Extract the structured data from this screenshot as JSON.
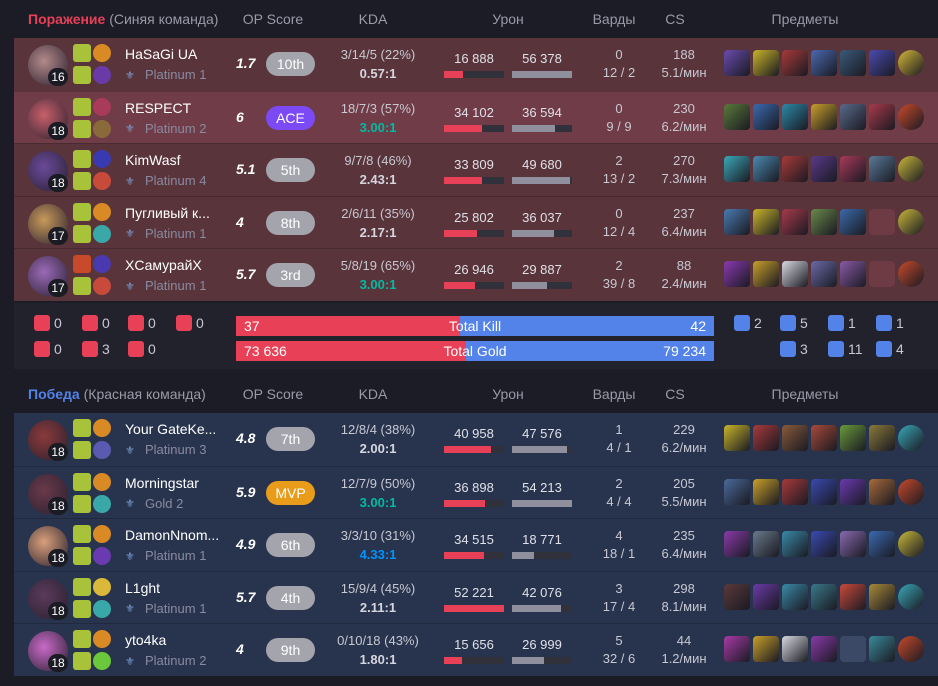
{
  "colors": {
    "loss": "#e84057",
    "win": "#5383e8",
    "ace": "#7b4af5",
    "mvp": "#e89c1a",
    "kda_good": "#00bba3",
    "kda_great": "#0093ff"
  },
  "columns": {
    "op_score": "OP Score",
    "kda": "KDA",
    "damage": "Урон",
    "wards": "Варды",
    "cs": "CS",
    "items": "Предметы"
  },
  "blue_team": {
    "result": "Поражение",
    "side": "(Синяя команда)",
    "players": [
      {
        "name": "HaSaGi UA",
        "level": "16",
        "tier": "Platinum 1",
        "score": "1.7",
        "rank": "10th",
        "kda": "3/14/5 (22%)",
        "ratio": "0.57:1",
        "dealt": "16 888",
        "taken": "56 378",
        "dealt_pct": 0.32,
        "taken_pct": 1.0,
        "wards": "0",
        "wards2": "12 / 2",
        "cs": "188",
        "cspm": "5.1/мин",
        "champ": "#b38a8a",
        "spells": [
          "#a8c23a",
          "#d98a24",
          "#a8c23a",
          "#6a3aa8"
        ],
        "items": [
          "#6a4bb0",
          "#c9b52a",
          "#a83a3a",
          "#4a6ab0",
          "#3a5a7a",
          "#4a4ab0",
          "#d4b83a"
        ]
      },
      {
        "name": "RESPECT",
        "level": "18",
        "tier": "Platinum 2",
        "score": "6",
        "rank": "ACE",
        "kda": "18/7/3 (57%)",
        "ratio": "3.00:1",
        "ratio_style": "green",
        "dealt": "34 102",
        "taken": "36 594",
        "dealt_pct": 0.64,
        "taken_pct": 0.71,
        "wards": "0",
        "wards2": "9 / 9",
        "cs": "230",
        "cspm": "6.2/мин",
        "champ": "#c8606a",
        "spells": [
          "#a8c23a",
          "#a83a5a",
          "#a8c23a",
          "#8a6a3a"
        ],
        "items": [
          "#5a7a3a",
          "#3a6ab0",
          "#2a8aa8",
          "#c9a02a",
          "#5a6a8a",
          "#a83a4a",
          "#c84a2a"
        ]
      },
      {
        "name": "KimWasf",
        "level": "18",
        "tier": "Platinum 4",
        "score": "5.1",
        "rank": "5th",
        "kda": "9/7/8 (46%)",
        "ratio": "2.43:1",
        "dealt": "33 809",
        "taken": "49 680",
        "dealt_pct": 0.63,
        "taken_pct": 0.97,
        "wards": "2",
        "wards2": "13 / 2",
        "cs": "270",
        "cspm": "7.3/мин",
        "champ": "#6a4a9a",
        "spells": [
          "#a8c23a",
          "#3a3ab0",
          "#a8c23a",
          "#c84a3a"
        ],
        "items": [
          "#3aa8b8",
          "#4a8ab0",
          "#a83a3a",
          "#5a3a8a",
          "#a83a5a",
          "#5a7a9a",
          "#c8b83a"
        ]
      },
      {
        "name": "Пугливый к...",
        "level": "17",
        "tier": "Platinum 1",
        "score": "4",
        "rank": "8th",
        "kda": "2/6/11 (35%)",
        "ratio": "2.17:1",
        "dealt": "25 802",
        "taken": "36 037",
        "dealt_pct": 0.55,
        "taken_pct": 0.7,
        "wards": "0",
        "wards2": "12 / 4",
        "cs": "237",
        "cspm": "6.4/мин",
        "champ": "#c89a5a",
        "spells": [
          "#a8c23a",
          "#d98a24",
          "#a8c23a",
          "#3aa8a8"
        ],
        "items": [
          "#4a7ab0",
          "#c9b52a",
          "#a83a4a",
          "#6a8a4a",
          "#3a6aa8",
          "empty",
          "#c8b83a"
        ]
      },
      {
        "name": "XСамурайX",
        "level": "17",
        "tier": "Platinum 1",
        "score": "5.7",
        "rank": "3rd",
        "kda": "5/8/19 (65%)",
        "ratio": "3.00:1",
        "ratio_style": "green",
        "dealt": "26 946",
        "taken": "29 887",
        "dealt_pct": 0.52,
        "taken_pct": 0.58,
        "wards": "2",
        "wards2": "39 / 8",
        "cs": "88",
        "cspm": "2.4/мин",
        "champ": "#9a6ab8",
        "spells": [
          "#c84a2a",
          "#4a3ab0",
          "#a8c23a",
          "#c84a3a"
        ],
        "items": [
          "#8a3ab0",
          "#c9a02a",
          "#d8d8e0",
          "#6a6aa8",
          "#8a5aa8",
          "empty",
          "#c84a2a"
        ]
      }
    ]
  },
  "summary": {
    "red_baron": "0",
    "red_dragon": "0",
    "red_herald": "0",
    "red_grubs": "0",
    "red_tower": "0",
    "red_inhib": "3",
    "red_atakhan": "0",
    "blue_baron": "2",
    "blue_dragon": "5",
    "blue_herald": "1",
    "blue_grubs": "1",
    "blue_tower": "3",
    "blue_inhib": "11",
    "blue_atakhan": "4",
    "kill_label": "Total Kill",
    "kill_left": "37",
    "kill_right": "42",
    "kill_left_share": 0.468,
    "gold_label": "Total Gold",
    "gold_left": "73 636",
    "gold_right": "79 234",
    "gold_left_share": 0.482
  },
  "red_team": {
    "result": "Победа",
    "side": "(Красная команда)",
    "players": [
      {
        "name": "Your GateKe...",
        "level": "18",
        "tier": "Platinum 3",
        "score": "4.8",
        "rank": "7th",
        "kda": "12/8/4 (38%)",
        "ratio": "2.00:1",
        "dealt": "40 958",
        "taken": "47 576",
        "dealt_pct": 0.78,
        "taken_pct": 0.92,
        "wards": "1",
        "wards2": "4 / 1",
        "cs": "229",
        "cspm": "6.2/мин",
        "champ": "#8a3a3a",
        "spells": [
          "#a8c23a",
          "#d98a24",
          "#a8c23a",
          "#5a5ab0"
        ],
        "items": [
          "#c9b52a",
          "#a83a3a",
          "#8a5a3a",
          "#a84a3a",
          "#6a9a3a",
          "#8a7a3a",
          "#3aa8b8"
        ]
      },
      {
        "name": "Morningstar",
        "level": "18",
        "tier": "Gold 2",
        "score": "5.9",
        "rank": "MVP",
        "kda": "12/7/9 (50%)",
        "ratio": "3.00:1",
        "ratio_style": "green",
        "dealt": "36 898",
        "taken": "54 213",
        "dealt_pct": 0.69,
        "taken_pct": 1.0,
        "wards": "2",
        "wards2": "4 / 4",
        "cs": "205",
        "cspm": "5.5/мин",
        "champ": "#6a3a4a",
        "spells": [
          "#a8c23a",
          "#d98a24",
          "#a8c23a",
          "#3aa8a8"
        ],
        "items": [
          "#4a6a9a",
          "#c9a02a",
          "#a83a3a",
          "#3a4ab0",
          "#6a3ab0",
          "#a86a3a",
          "#c84a2a"
        ]
      },
      {
        "name": "DamonNnom...",
        "level": "18",
        "tier": "Platinum 1",
        "score": "4.9",
        "rank": "6th",
        "kda": "3/3/10 (31%)",
        "ratio": "4.33:1",
        "ratio_style": "blue",
        "dealt": "34 515",
        "taken": "18 771",
        "dealt_pct": 0.66,
        "taken_pct": 0.36,
        "wards": "4",
        "wards2": "18 / 1",
        "cs": "235",
        "cspm": "6.4/мин",
        "champ": "#d8a07a",
        "spells": [
          "#a8c23a",
          "#d98a24",
          "#a8c23a",
          "#6a3ab0"
        ],
        "items": [
          "#8a3aa8",
          "#6a7a8a",
          "#3a8aa8",
          "#3a4ab0",
          "#8a6ab0",
          "#3a6ab0",
          "#c8b83a"
        ]
      },
      {
        "name": "L1ght",
        "level": "18",
        "tier": "Platinum 1",
        "score": "5.7",
        "rank": "4th",
        "kda": "15/9/4 (45%)",
        "ratio": "2.11:1",
        "dealt": "52 221",
        "taken": "42 076",
        "dealt_pct": 1.0,
        "taken_pct": 0.82,
        "wards": "3",
        "wards2": "17 / 4",
        "cs": "298",
        "cspm": "8.1/мин",
        "champ": "#5a3a5a",
        "spells": [
          "#a8c23a",
          "#d9b83a",
          "#a8c23a",
          "#3aa8a8"
        ],
        "items": [
          "#5a3a3a",
          "#6a3aa8",
          "#3a8aa8",
          "#3a7a8a",
          "#c84a3a",
          "#a88a3a",
          "#3aa8b8"
        ]
      },
      {
        "name": "yto4ka",
        "level": "18",
        "tier": "Platinum 2",
        "score": "4",
        "rank": "9th",
        "kda": "0/10/18 (43%)",
        "ratio": "1.80:1",
        "dealt": "15 656",
        "taken": "26 999",
        "dealt_pct": 0.3,
        "taken_pct": 0.53,
        "wards": "5",
        "wards2": "32 / 6",
        "cs": "44",
        "cspm": "1.2/мин",
        "champ": "#c86ac8",
        "spells": [
          "#a8c23a",
          "#d98a24",
          "#a8c23a",
          "#6ac83a"
        ],
        "items": [
          "#a83aa8",
          "#c9a02a",
          "#d8d8e0",
          "#8a3aa8",
          "empty",
          "#3a8a9a",
          "#c84a2a"
        ]
      }
    ]
  }
}
